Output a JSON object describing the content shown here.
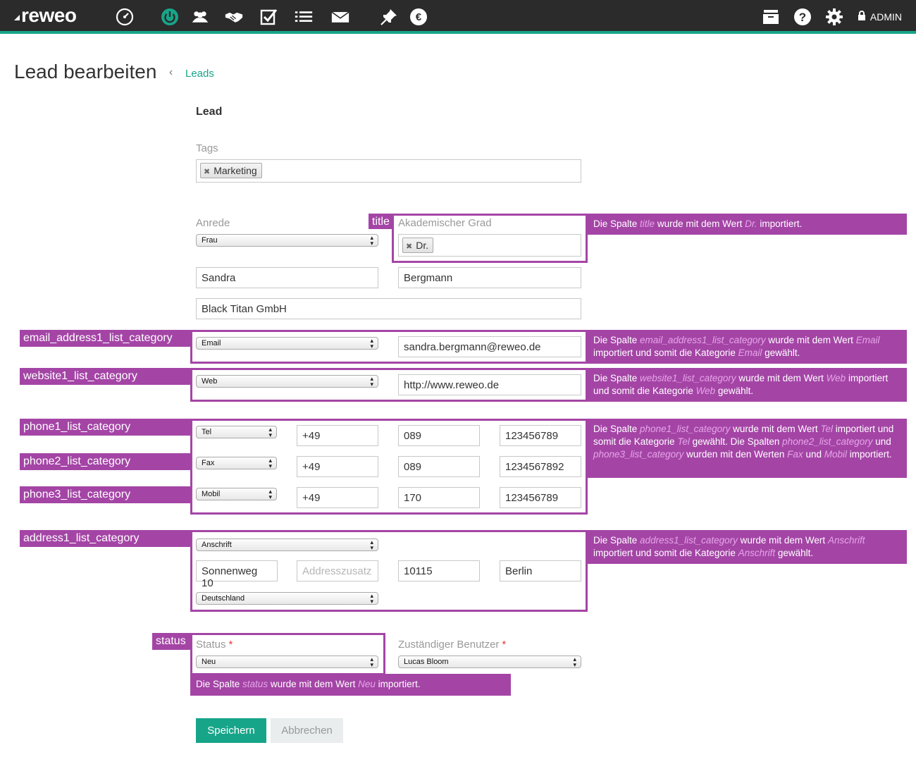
{
  "app": {
    "logo": "reweo",
    "user": "ADMIN"
  },
  "page": {
    "title": "Lead bearbeiten",
    "breadcrumb": "Leads",
    "section": "Lead"
  },
  "form": {
    "tags_label": "Tags",
    "tags": [
      "Marketing"
    ],
    "salutation_label": "Anrede",
    "salutation": "Frau",
    "academic_label": "Akademischer Grad",
    "academic": "Dr.",
    "first_name": "Sandra",
    "last_name": "Bergmann",
    "company": "Black Titan GmbH",
    "email_category": "Email",
    "email": "sandra.bergmann@reweo.de",
    "web_category": "Web",
    "website": "http://www.reweo.de",
    "phones": [
      {
        "category": "Tel",
        "country": "+49",
        "area": "089",
        "number": "123456789"
      },
      {
        "category": "Fax",
        "country": "+49",
        "area": "089",
        "number": "1234567892"
      },
      {
        "category": "Mobil",
        "country": "+49",
        "area": "170",
        "number": "123456789"
      }
    ],
    "address_category": "Anschrift",
    "street": "Sonnenweg 10",
    "address_extra_placeholder": "Addresszusatz",
    "zip": "10115",
    "city": "Berlin",
    "country": "Deutschland",
    "status_label": "Status",
    "status": "Neu",
    "owner_label": "Zuständiger Benutzer",
    "owner": "Lucas Bloom",
    "required_mark": "*",
    "save_label": "Speichern",
    "cancel_label": "Abbrechen"
  },
  "annotations": {
    "color": "#a445a6",
    "labels": {
      "title": "title",
      "email": "email_address1_list_category",
      "website": "website1_list_category",
      "phone1": "phone1_list_category",
      "phone2": "phone2_list_category",
      "phone3": "phone3_list_category",
      "address": "address1_list_category",
      "status": "status"
    }
  },
  "icons": [
    "dashboard-icon",
    "power-icon",
    "contacts-icon",
    "handshake-icon",
    "checklist-icon",
    "list-icon",
    "mail-icon",
    "pin-icon",
    "euro-icon",
    "archive-icon",
    "help-icon",
    "settings-icon",
    "lock-icon"
  ]
}
